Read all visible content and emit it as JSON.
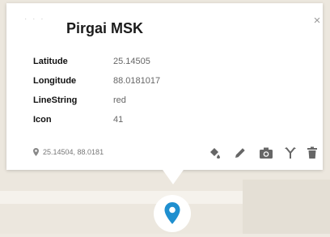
{
  "popup": {
    "title": "Pirgai MSK",
    "close_glyph": "×",
    "attributes": [
      {
        "key": "Latitude",
        "value": "25.14505"
      },
      {
        "key": "Longitude",
        "value": "88.0181017"
      },
      {
        "key": "LineString",
        "value": "red"
      },
      {
        "key": "Icon",
        "value": "41"
      }
    ],
    "coordinates": "25.14504, 88.0181",
    "tools": [
      {
        "name": "fill-style-icon"
      },
      {
        "name": "pencil-icon"
      },
      {
        "name": "camera-icon"
      },
      {
        "name": "merge-icon"
      },
      {
        "name": "trash-icon"
      }
    ]
  },
  "colors": {
    "marker": "#1f8fcf",
    "map_background": "#ece7de"
  }
}
